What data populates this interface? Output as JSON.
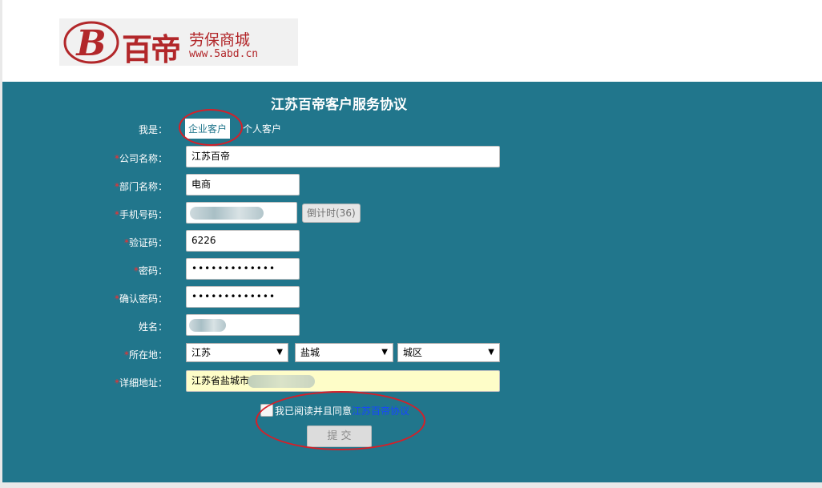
{
  "brand": {
    "logo_letter": "B",
    "name": "百帝",
    "tagline": "劳保商城",
    "url": "www.5abd.cn",
    "color": "#b2272a"
  },
  "form": {
    "title": "江苏百帝客户服务协议",
    "identity_label": "我是：",
    "identity_options": [
      "企业客户",
      "个人客户"
    ],
    "fields": {
      "company_label": "公司名称：",
      "company_value": "江苏百帝",
      "department_label": "部门名称：",
      "department_value": "电商",
      "phone_label": "手机号码：",
      "countdown_button": "倒计时(36)",
      "code_label": "验证码：",
      "code_value": "6226",
      "password_label": "密码：",
      "password_value": "•••••••••••••",
      "confirm_label": "确认密码：",
      "confirm_value": "•••••••••••••",
      "name_label": "姓名：",
      "location_label": "所在地：",
      "province": "江苏",
      "city": "盐城",
      "district": "城区",
      "address_label": "详细地址：",
      "address_value": "江苏省盐城市"
    },
    "required_mark": "*",
    "agree_text": "我已阅读并且同意",
    "agree_link": "江苏百帝协议",
    "submit_label": "提 交"
  },
  "icons": {
    "dropdown": "▼"
  },
  "colors": {
    "panel": "#21768c",
    "required": "#ff2b2b",
    "link": "#1746ff",
    "annotation": "#d61f28"
  }
}
